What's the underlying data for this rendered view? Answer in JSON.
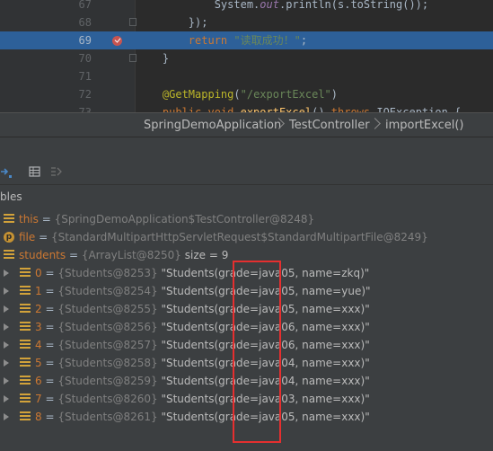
{
  "editor": {
    "lines": [
      {
        "num": "67",
        "segments": [
          {
            "t": "            System.",
            "c": ""
          },
          {
            "t": "out",
            "c": "k-out"
          },
          {
            "t": ".println(s.toString());",
            "c": ""
          }
        ]
      },
      {
        "num": "68",
        "segments": [
          {
            "t": "        });",
            "c": ""
          }
        ]
      },
      {
        "num": "69",
        "segments": [
          {
            "t": "        ",
            "c": ""
          },
          {
            "t": "return ",
            "c": "k-kw"
          },
          {
            "t": "\"读取成功！\"",
            "c": "k-str"
          },
          {
            "t": ";",
            "c": ""
          }
        ]
      },
      {
        "num": "70",
        "segments": [
          {
            "t": "    }",
            "c": ""
          }
        ]
      },
      {
        "num": "71",
        "segments": []
      },
      {
        "num": "72",
        "segments": [
          {
            "t": "    ",
            "c": ""
          },
          {
            "t": "@GetMapping",
            "c": "k-ann"
          },
          {
            "t": "(",
            "c": ""
          },
          {
            "t": "\"/exportExcel\"",
            "c": "k-str"
          },
          {
            "t": ")",
            "c": ""
          }
        ]
      },
      {
        "num": "73",
        "segments": [
          {
            "t": "    ",
            "c": ""
          },
          {
            "t": "public void ",
            "c": "k-kw"
          },
          {
            "t": "exportExcel",
            "c": "k-fn"
          },
          {
            "t": "() ",
            "c": ""
          },
          {
            "t": "throws ",
            "c": "k-kw"
          },
          {
            "t": "IOException {",
            "c": ""
          }
        ]
      }
    ]
  },
  "breadcrumb": {
    "items": [
      "SpringDemoApplication",
      "TestController",
      "importExcel()"
    ]
  },
  "debug": {
    "variables_header": "bles",
    "rows": [
      {
        "level": 0,
        "expand": false,
        "icon": "field",
        "name": "this",
        "eq": " = ",
        "ref": "{SpringDemoApplication$TestController@8248}",
        "value": ""
      },
      {
        "level": 0,
        "expand": false,
        "icon": "param",
        "name": "file",
        "eq": " = ",
        "ref": "{StandardMultipartHttpServletRequest$StandardMultipartFile@8249}",
        "value": ""
      },
      {
        "level": 0,
        "expand": false,
        "icon": "field",
        "name": "students",
        "eq": " = ",
        "ref": "{ArrayList@8250}",
        "value": "  size = 9"
      },
      {
        "level": 1,
        "expand": true,
        "icon": "field",
        "name": "0",
        "eq": " = ",
        "ref": "{Students@8253}",
        "value": " \"Students(grade=java05, name=zkq)\""
      },
      {
        "level": 1,
        "expand": true,
        "icon": "field",
        "name": "1",
        "eq": " = ",
        "ref": "{Students@8254}",
        "value": " \"Students(grade=java05, name=yue)\""
      },
      {
        "level": 1,
        "expand": true,
        "icon": "field",
        "name": "2",
        "eq": " = ",
        "ref": "{Students@8255}",
        "value": " \"Students(grade=java05, name=xxx)\""
      },
      {
        "level": 1,
        "expand": true,
        "icon": "field",
        "name": "3",
        "eq": " = ",
        "ref": "{Students@8256}",
        "value": " \"Students(grade=java06, name=xxx)\""
      },
      {
        "level": 1,
        "expand": true,
        "icon": "field",
        "name": "4",
        "eq": " = ",
        "ref": "{Students@8257}",
        "value": " \"Students(grade=java06, name=xxx)\""
      },
      {
        "level": 1,
        "expand": true,
        "icon": "field",
        "name": "5",
        "eq": " = ",
        "ref": "{Students@8258}",
        "value": " \"Students(grade=java04, name=xxx)\""
      },
      {
        "level": 1,
        "expand": true,
        "icon": "field",
        "name": "6",
        "eq": " = ",
        "ref": "{Students@8259}",
        "value": " \"Students(grade=java04, name=xxx)\""
      },
      {
        "level": 1,
        "expand": true,
        "icon": "field",
        "name": "7",
        "eq": " = ",
        "ref": "{Students@8260}",
        "value": " \"Students(grade=java03, name=xxx)\""
      },
      {
        "level": 1,
        "expand": true,
        "icon": "field",
        "name": "8",
        "eq": " = ",
        "ref": "{Students@8261}",
        "value": " \"Students(grade=java05, name=xxx)\""
      }
    ]
  },
  "colors": {
    "highlight_line": "#2d6099",
    "annotation_box": "#e52f2f",
    "var_name": "#cc7832"
  }
}
